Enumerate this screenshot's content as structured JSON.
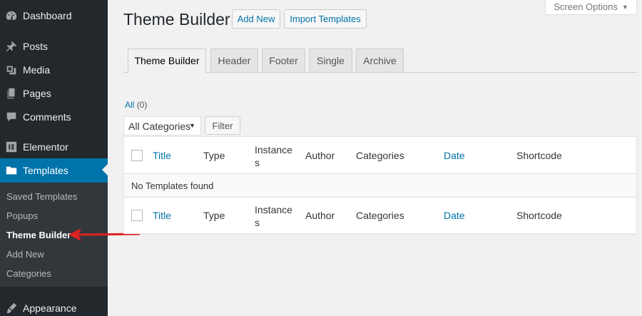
{
  "sidebar": {
    "items": [
      {
        "label": "Dashboard",
        "icon": "dashboard-icon"
      },
      {
        "label": "Posts",
        "icon": "pin-icon"
      },
      {
        "label": "Media",
        "icon": "media-icon"
      },
      {
        "label": "Pages",
        "icon": "pages-icon"
      },
      {
        "label": "Comments",
        "icon": "comment-icon"
      },
      {
        "label": "Elementor",
        "icon": "elementor-icon"
      },
      {
        "label": "Templates",
        "icon": "folder-icon"
      },
      {
        "label": "Appearance",
        "icon": "brush-icon"
      }
    ],
    "submenu": [
      "Saved Templates",
      "Popups",
      "Theme Builder",
      "Add New",
      "Categories"
    ],
    "active": "Templates",
    "current_sub": "Theme Builder"
  },
  "header": {
    "title": "Theme Builder",
    "add_new": "Add New",
    "import": "Import Templates",
    "screen_options": "Screen Options"
  },
  "tabs": [
    "Theme Builder",
    "Header",
    "Footer",
    "Single",
    "Archive"
  ],
  "filters": {
    "all_label": "All",
    "all_count": "(0)",
    "category_selected": "All Categories",
    "filter_button": "Filter"
  },
  "table": {
    "columns": [
      "Title",
      "Type",
      "Instances",
      "Author",
      "Categories",
      "Date",
      "Shortcode"
    ],
    "instances_line1": "Instance",
    "instances_line2": "s",
    "empty_message": "No Templates found"
  },
  "colors": {
    "sidebar_bg": "#23282d",
    "active_bg": "#0073aa",
    "link": "#0073aa",
    "arrow": "#e02020"
  }
}
